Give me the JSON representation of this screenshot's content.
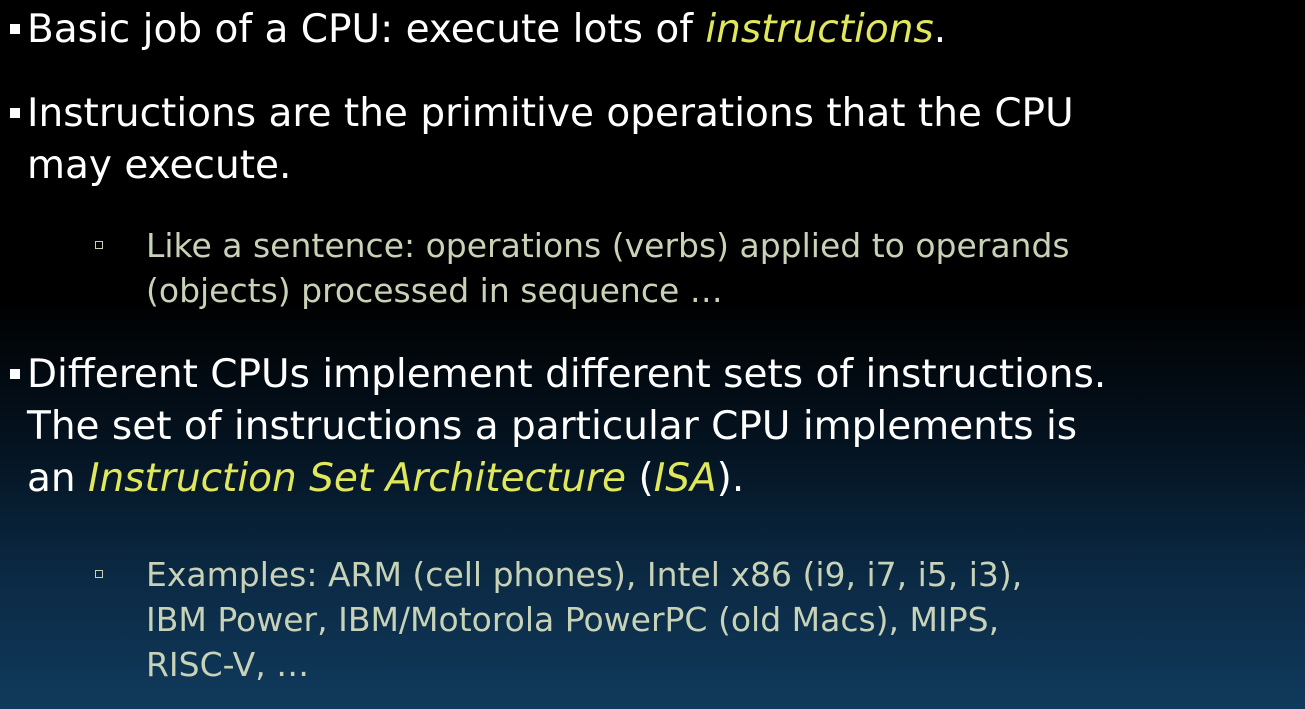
{
  "bullets": [
    {
      "lines": [
        [
          "Basic job of a CPU: execute lots of ",
          "instructions",
          "."
        ]
      ]
    },
    {
      "lines": [
        "Instructions are the primitive operations that the CPU",
        "may execute."
      ]
    },
    {
      "lines": [
        "Like a sentence: operations (verbs) applied to operands",
        "(objects) processed in sequence …"
      ]
    },
    {
      "lines": [
        "Different CPUs implement different sets of instructions.",
        "The set of instructions a particular CPU implements is",
        [
          "an ",
          "Instruction Set Architecture",
          " (",
          "ISA",
          ")."
        ]
      ]
    },
    {
      "lines": [
        "Examples: ARM (cell phones), Intel x86 (i9, i7, i5, i3),",
        "IBM Power, IBM/Motorola PowerPC (old Macs), MIPS,",
        "RISC-V, …"
      ]
    }
  ]
}
